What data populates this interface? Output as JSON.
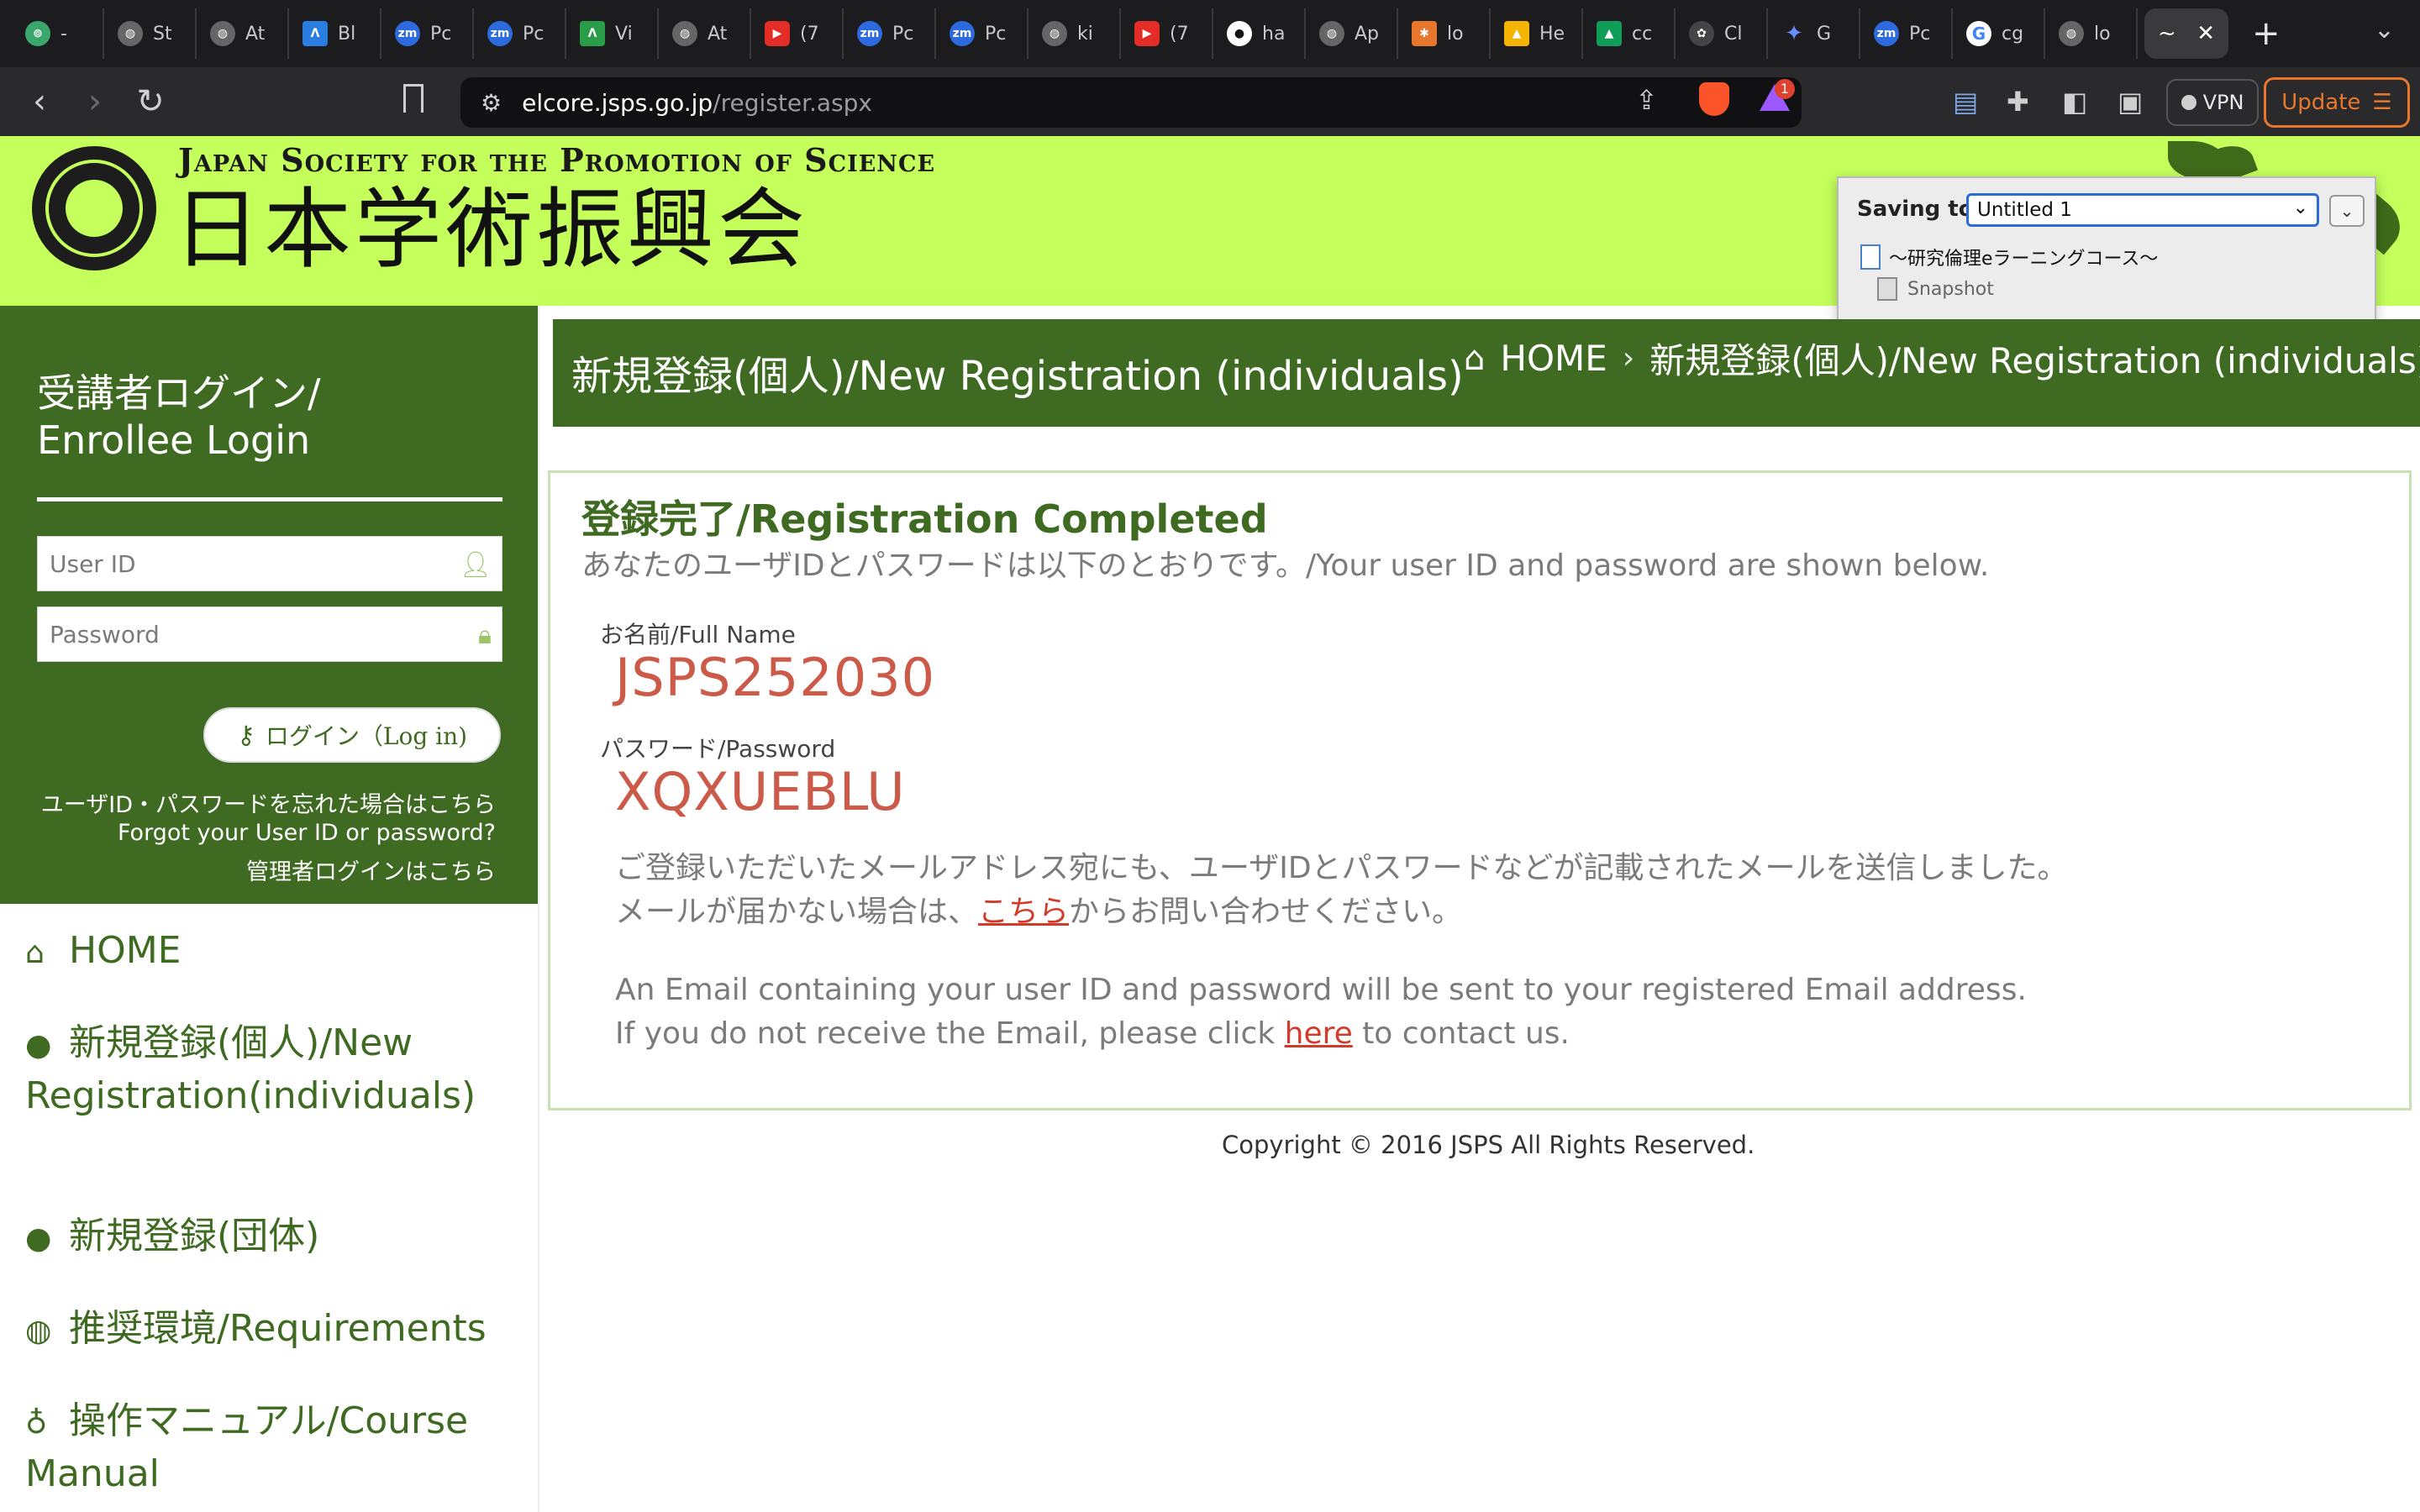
{
  "browser": {
    "tabs": [
      {
        "label": "- ",
        "icon": "app-icon",
        "color": "#3aa76d"
      },
      {
        "label": "St",
        "icon": "globe-icon",
        "color": "#666666"
      },
      {
        "label": "At",
        "icon": "globe-icon",
        "color": "#666666"
      },
      {
        "label": "Bl",
        "icon": "apple-tree-icon",
        "color": "#2a7de1"
      },
      {
        "label": "Pc",
        "icon": "zoom-icon",
        "color": "#2d6ae0"
      },
      {
        "label": "Pc",
        "icon": "zoom-icon",
        "color": "#2d6ae0"
      },
      {
        "label": "Vi",
        "icon": "apple-tree-icon",
        "color": "#2a9d49"
      },
      {
        "label": "At",
        "icon": "globe-icon",
        "color": "#666666"
      },
      {
        "label": "(7",
        "icon": "youtube-icon",
        "color": "#e52d27"
      },
      {
        "label": "Pc",
        "icon": "zoom-icon",
        "color": "#2d6ae0"
      },
      {
        "label": "Pc",
        "icon": "zoom-icon",
        "color": "#2d6ae0"
      },
      {
        "label": "ki",
        "icon": "globe-icon",
        "color": "#666666"
      },
      {
        "label": "(7",
        "icon": "youtube-icon",
        "color": "#e52d27"
      },
      {
        "label": "ha",
        "icon": "github-icon",
        "color": "#ffffff"
      },
      {
        "label": "Ap",
        "icon": "globe-icon",
        "color": "#666666"
      },
      {
        "label": "lo",
        "icon": "overleaf-icon",
        "color": "#e8772e"
      },
      {
        "label": "He",
        "icon": "drive-icon",
        "color": "#f4b400"
      },
      {
        "label": "cc",
        "icon": "drive-icon",
        "color": "#0f9d58"
      },
      {
        "label": "Cl",
        "icon": "openai-icon",
        "color": "#bbbbbb"
      },
      {
        "label": "G",
        "icon": "sparkle-icon",
        "color": "#6b8cff"
      },
      {
        "label": "Pc",
        "icon": "zoom-icon",
        "color": "#2d6ae0"
      },
      {
        "label": "cg",
        "icon": "google-icon",
        "color": "#ffffff"
      },
      {
        "label": "lo",
        "icon": "globe-icon",
        "color": "#666666"
      }
    ],
    "active_tab_label": "~",
    "url_host": "elcore.jsps.go.jp",
    "url_path": "/register.aspx",
    "rewards_count": "1",
    "vpn_label": "VPN",
    "update_label": "Update"
  },
  "header": {
    "org_en": "Japan Society for the Promotion of Science",
    "org_jp": "日本学術振興会",
    "bg_color": "#c4ff5c"
  },
  "popup": {
    "saving_label": "Saving to",
    "selected": "Untitled 1",
    "doc_title": "～研究倫理eラーニングコース～",
    "snapshot": "Snapshot"
  },
  "sidebar": {
    "login_title_line1": "受講者ログイン/",
    "login_title_line2": "Enrollee Login",
    "userid_placeholder": "User ID",
    "password_placeholder": "Password",
    "login_button": "ログイン（Log in)",
    "forgot_jp": "ユーザID・パスワードを忘れた場合はこちら",
    "forgot_en": "Forgot your User ID or password?",
    "admin_login": "管理者ログインはこちら",
    "nav": [
      {
        "label": "HOME",
        "icon": "home-icon"
      },
      {
        "label": "新規登録(個人)/New Registration(individuals)",
        "icon": "user-icon"
      },
      {
        "label": "新規登録(団体)",
        "icon": "user-icon"
      },
      {
        "label": "推奨環境/Requirements",
        "icon": "globe-icon"
      },
      {
        "label": "操作マニュアル/Course Manual",
        "icon": "lightbulb-icon"
      }
    ],
    "accent_color": "#3f6a22"
  },
  "main": {
    "page_title": "新規登録(個人)/New Registration (individuals)",
    "breadcrumb_home": "HOME",
    "breadcrumb_current": "新規登録(個人)/New Registration (individuals)",
    "card_title": "登録完了/Registration Completed",
    "card_subtitle": "あなたのユーザIDとパスワードは以下のとおりです。/Your user ID and password are shown below.",
    "name_label": "お名前/Full Name",
    "name_value": "JSPS252030",
    "password_label": "パスワード/Password",
    "password_value": "XQXUEBLU",
    "msg_jp_1": "ご登録いただいたメールアドレス宛にも、ユーザIDとパスワードなどが記載されたメールを送信しました。",
    "msg_jp_2_pre": "メールが届かない場合は、",
    "msg_jp_2_link": "こちら",
    "msg_jp_2_post": "からお問い合わせください。",
    "msg_en_1": "An Email containing your user ID and password will be sent to your registered Email address.",
    "msg_en_2_pre": "If you do not receive the Email, please click ",
    "msg_en_2_link": "here",
    "msg_en_2_post": " to contact us.",
    "value_color": "#cc5a49"
  },
  "footer": {
    "copyright": "Copyright © 2016 JSPS All Rights Reserved."
  }
}
